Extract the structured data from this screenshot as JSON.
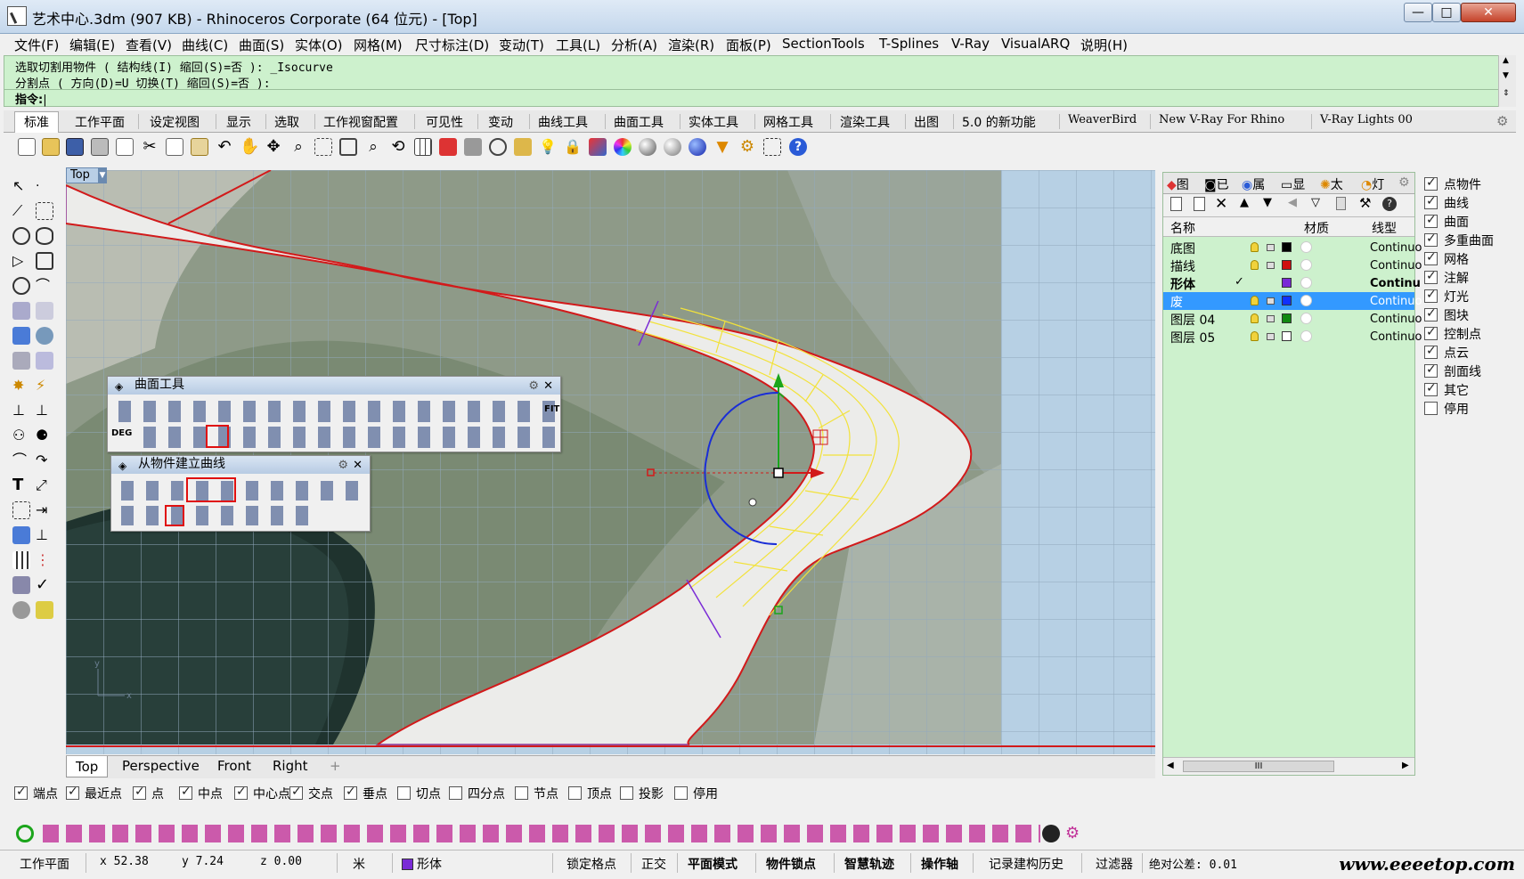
{
  "window": {
    "title": "艺术中心.3dm (907 KB) - Rhinoceros Corporate (64 位元) - [Top]",
    "minimize": "—",
    "maximize": "□",
    "close": "✕"
  },
  "menu": [
    "文件(F)",
    "编辑(E)",
    "查看(V)",
    "曲线(C)",
    "曲面(S)",
    "实体(O)",
    "网格(M)",
    "尺寸标注(D)",
    "变动(T)",
    "工具(L)",
    "分析(A)",
    "渲染(R)",
    "面板(P)",
    "SectionTools",
    "T-Splines",
    "V-Ray",
    "VisualARQ",
    "说明(H)"
  ],
  "command": {
    "line1": "选取切割用物件 ( 结构线(I)  缩回(S)=否 ): _Isocurve",
    "line2": "分割点 ( 方向(D)=U  切换(T)  缩回(S)=否 ):",
    "prompt": "指令:"
  },
  "toolbar_tabs": [
    "标准",
    "工作平面",
    "设定视图",
    "显示",
    "选取",
    "工作视窗配置",
    "可见性",
    "变动",
    "曲线工具",
    "曲面工具",
    "实体工具",
    "网格工具",
    "渲染工具",
    "出图",
    "5.0 的新功能",
    "WeaverBird",
    "New V-Ray For Rhino",
    "V-Ray Lights 00"
  ],
  "viewport": {
    "label": "Top",
    "axis_x": "x",
    "axis_y": "y",
    "tabs": [
      "Top",
      "Perspective",
      "Front",
      "Right",
      "+"
    ]
  },
  "floating_toolbars": {
    "surface_tools": {
      "title": "曲面工具",
      "deg": "DEG",
      "fit": "FIT"
    },
    "curves_from_objects": {
      "title": "从物件建立曲线"
    }
  },
  "layer_panel": {
    "tabs": [
      "图",
      "已",
      "属",
      "显",
      "太",
      "灯"
    ],
    "headers": {
      "name": "名称",
      "material": "材质",
      "linetype": "线型"
    },
    "layers": [
      {
        "name": "底图",
        "color": "#000000",
        "linetype": "Continuo",
        "current": "",
        "selected": false,
        "bold": false
      },
      {
        "name": "描线",
        "color": "#d01010",
        "linetype": "Continuo",
        "current": "",
        "selected": false,
        "bold": false
      },
      {
        "name": "形体",
        "color": "#7a2bd6",
        "linetype": "Continu",
        "current": "✓",
        "selected": false,
        "bold": true
      },
      {
        "name": "废",
        "color": "#1030ff",
        "linetype": "Continuo",
        "current": "",
        "selected": true,
        "bold": false
      },
      {
        "name": "图层 04",
        "color": "#118811",
        "linetype": "Continuo",
        "current": "",
        "selected": false,
        "bold": false
      },
      {
        "name": "图层 05",
        "color": "#ffffff",
        "linetype": "Continuo",
        "current": "",
        "selected": false,
        "bold": false
      }
    ],
    "scroll_thumb": "III"
  },
  "filters": [
    {
      "label": "点物件",
      "checked": true
    },
    {
      "label": "曲线",
      "checked": true
    },
    {
      "label": "曲面",
      "checked": true
    },
    {
      "label": "多重曲面",
      "checked": true
    },
    {
      "label": "网格",
      "checked": true
    },
    {
      "label": "注解",
      "checked": true
    },
    {
      "label": "灯光",
      "checked": true
    },
    {
      "label": "图块",
      "checked": true
    },
    {
      "label": "控制点",
      "checked": true
    },
    {
      "label": "点云",
      "checked": true
    },
    {
      "label": "剖面线",
      "checked": true
    },
    {
      "label": "其它",
      "checked": true
    },
    {
      "label": "停用",
      "checked": false
    }
  ],
  "osnaps": [
    {
      "label": "端点",
      "checked": true
    },
    {
      "label": "最近点",
      "checked": true
    },
    {
      "label": "点",
      "checked": true
    },
    {
      "label": "中点",
      "checked": true
    },
    {
      "label": "中心点",
      "checked": true
    },
    {
      "label": "交点",
      "checked": true
    },
    {
      "label": "垂点",
      "checked": true
    },
    {
      "label": "切点",
      "checked": false
    },
    {
      "label": "四分点",
      "checked": false
    },
    {
      "label": "节点",
      "checked": false
    },
    {
      "label": "顶点",
      "checked": false
    },
    {
      "label": "投影",
      "checked": false
    },
    {
      "label": "停用",
      "checked": false
    }
  ],
  "status": {
    "cplane": "工作平面",
    "x": "x 52.38",
    "y": "y 7.24",
    "z": "z 0.00",
    "unit": "米",
    "layer": "形体",
    "layer_color": "#7a2bd6",
    "grid_snap": "锁定格点",
    "ortho": "正交",
    "planar": "平面模式",
    "osnap": "物件锁点",
    "smarttrack": "智慧轨迹",
    "gumball": "操作轴",
    "history": "记录建构历史",
    "filter": "过滤器",
    "tolerance": "绝对公差: 0.01"
  },
  "watermark": "www.eeeetop.com"
}
